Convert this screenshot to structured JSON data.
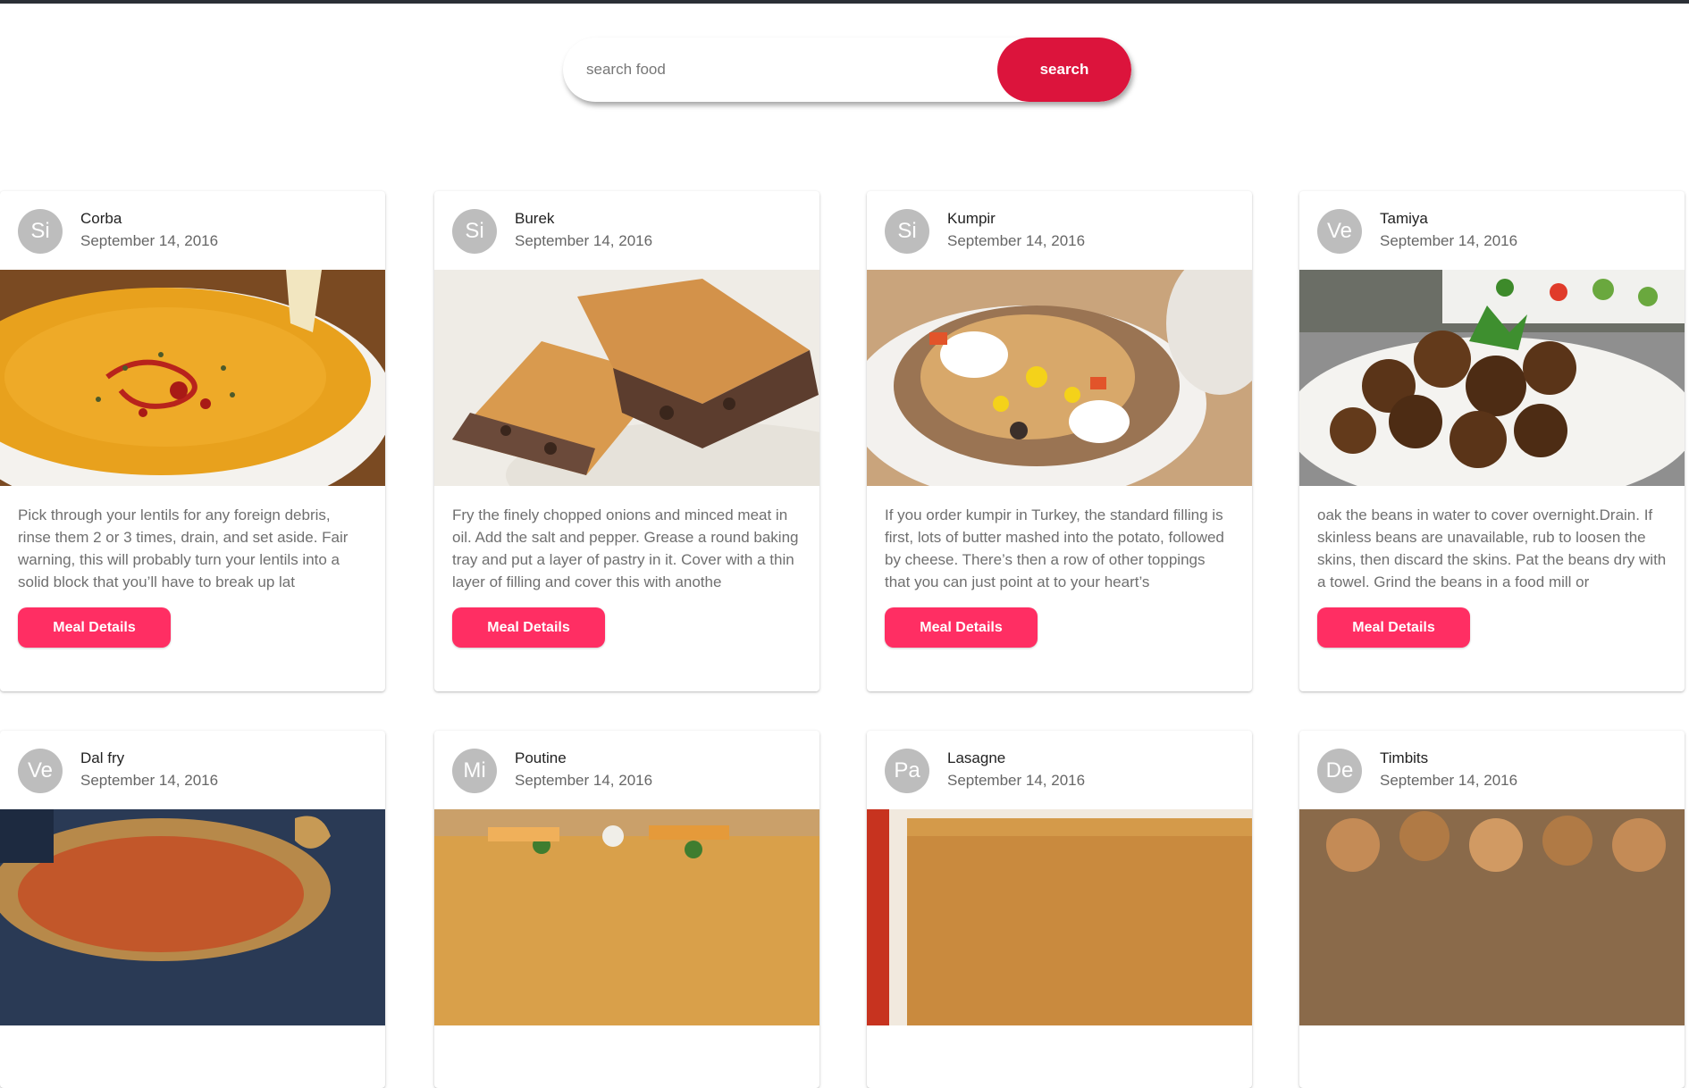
{
  "search": {
    "placeholder": "search food",
    "button_label": "search"
  },
  "meals": [
    {
      "avatar": "Si",
      "name": "Corba",
      "date": "September 14, 2016",
      "description": "Pick through your lentils for any foreign debris, rinse them 2 or 3 times, drain, and set aside. Fair warning, this will probably turn your lentils into a solid block that you’ll have to break up lat",
      "button_label": "Meal Details",
      "image_color": "#e9a21c"
    },
    {
      "avatar": "Si",
      "name": "Burek",
      "date": "September 14, 2016",
      "description": "Fry the finely chopped onions and minced meat in oil. Add the salt and pepper. Grease a round baking tray and put a layer of pastry in it. Cover with a thin layer of filling and cover this with anothe",
      "button_label": "Meal Details",
      "image_color": "#c9935a"
    },
    {
      "avatar": "Si",
      "name": "Kumpir",
      "date": "September 14, 2016",
      "description": "If you order kumpir in Turkey, the standard filling is first, lots of butter mashed into the potato, followed by cheese. There’s then a row of other toppings that you can just point at to your heart’s",
      "button_label": "Meal Details",
      "image_color": "#b98a5a"
    },
    {
      "avatar": "Ve",
      "name": "Tamiya",
      "date": "September 14, 2016",
      "description": "oak the beans in water to cover overnight.Drain. If skinless beans are unavailable, rub to loosen the skins, then discard the skins. Pat the beans dry with a towel. Grind the beans in a food mill or",
      "button_label": "Meal Details",
      "image_color": "#5a3418"
    },
    {
      "avatar": "Ve",
      "name": "Dal fry",
      "date": "September 14, 2016",
      "image_color": "#2a3a55"
    },
    {
      "avatar": "Mi",
      "name": "Poutine",
      "date": "September 14, 2016",
      "image_color": "#e2a23a"
    },
    {
      "avatar": "Pa",
      "name": "Lasagne",
      "date": "September 14, 2016",
      "image_color": "#c7331f"
    },
    {
      "avatar": "De",
      "name": "Timbits",
      "date": "September 14, 2016",
      "image_color": "#a9774a"
    }
  ]
}
